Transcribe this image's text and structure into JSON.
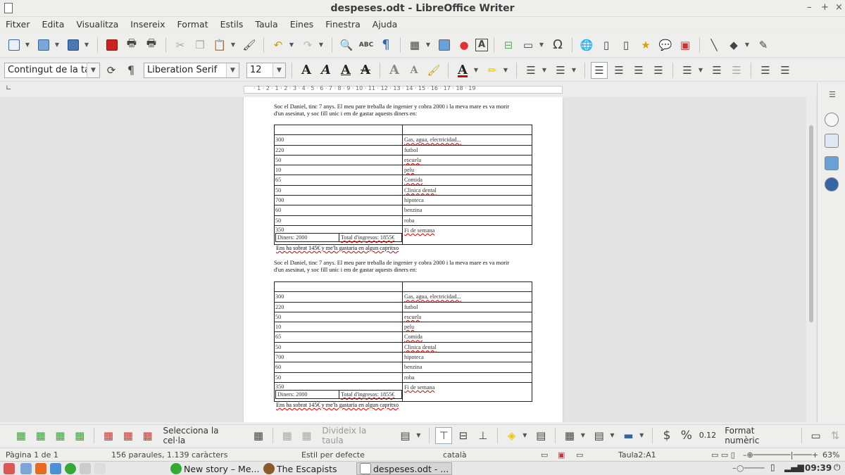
{
  "window": {
    "title": "despeses.odt - LibreOffice Writer"
  },
  "menu": [
    "Fitxer",
    "Edita",
    "Visualitza",
    "Insereix",
    "Format",
    "Estils",
    "Taula",
    "Eines",
    "Finestra",
    "Ajuda"
  ],
  "format_bar": {
    "paragraph_style": "Contingut de la tau",
    "font_name": "Liberation Serif",
    "font_size": "12"
  },
  "ruler": {
    "numbers": "· 1 · 2 · 1 · 2 · 3 · 4 · 5 · 6 · 7 · 8 · 9 · 10 · 11 · 12 · 13 · 14 · 15 · 16 · 17 · 18 · 19"
  },
  "document": {
    "blocks": [
      {
        "para_line1": "Soc el Daniel, tinc 7 anys. El meu pare treballa de ingenier y cobra 2000 i la meva mare es va morir",
        "para_line2": "d'un asesinat, y soc fill unic i em de gastar aquests diners en:",
        "rows": [
          {
            "amount": "",
            "item": ""
          },
          {
            "amount": "300",
            "item": "Gas, agua, electricidad..."
          },
          {
            "amount": "220",
            "item": "futbol"
          },
          {
            "amount": "50",
            "item": "escuela"
          },
          {
            "amount": "10",
            "item": "pelu"
          },
          {
            "amount": "65",
            "item": "Comida"
          },
          {
            "amount": "50",
            "item": "Clinica dental"
          },
          {
            "amount": "700",
            "item": "hipoteca"
          },
          {
            "amount": "60",
            "item": "benzina"
          },
          {
            "amount": "50",
            "item": "roba"
          },
          {
            "amount": "350",
            "item": "Fi de semana"
          }
        ],
        "diners": "Diners: 2000",
        "total": "Total d'ingresos: 1855€",
        "after": "Ens ha sobrat 145€ y me'ls gastaria en algun capritxo"
      },
      {
        "para_line1": "Soc el Daniel, tinc 7 anys. El meu pare treballa de ingenier y cobra 2000 i la meva mare es va morir",
        "para_line2": "d'un asesinat, y soc fill unic i em de gastar aquests diners en:",
        "rows": [
          {
            "amount": "",
            "item": ""
          },
          {
            "amount": "300",
            "item": "Gas, agua, electricidad..."
          },
          {
            "amount": "220",
            "item": "futbol"
          },
          {
            "amount": "50",
            "item": "escuela"
          },
          {
            "amount": "10",
            "item": "pelu"
          },
          {
            "amount": "65",
            "item": "Comida"
          },
          {
            "amount": "50",
            "item": "Clinica dental"
          },
          {
            "amount": "700",
            "item": "hipoteca"
          },
          {
            "amount": "60",
            "item": "benzina"
          },
          {
            "amount": "50",
            "item": "roba"
          },
          {
            "amount": "350",
            "item": "Fi de semana"
          }
        ],
        "diners": "Diners: 2000",
        "total": "Total d'ingresos: 1855€",
        "after": "Ens ha sobrat 145€ y me'ls gastaria en algun capritxo"
      }
    ]
  },
  "table_toolbar": {
    "select_cell": "Selecciona la cel·la",
    "split_table": "Divideix la taula",
    "number_value": "0.12",
    "number_format": "Format numèric",
    "dollar": "$",
    "percent": "%"
  },
  "status": {
    "page": "Pàgina 1 de 1",
    "words": "156 paraules, 1.139 caràcters",
    "style": "Estil per defecte",
    "language": "català",
    "cell": "Taula2:A1",
    "zoom": "63%"
  },
  "taskbar": {
    "item1": "New story – Me...",
    "item2": "The Escapists",
    "item3": "despeses.odt - ...",
    "time": "09:39"
  },
  "colors": {
    "accent": "#3465a4",
    "spell": "#dd0000"
  }
}
